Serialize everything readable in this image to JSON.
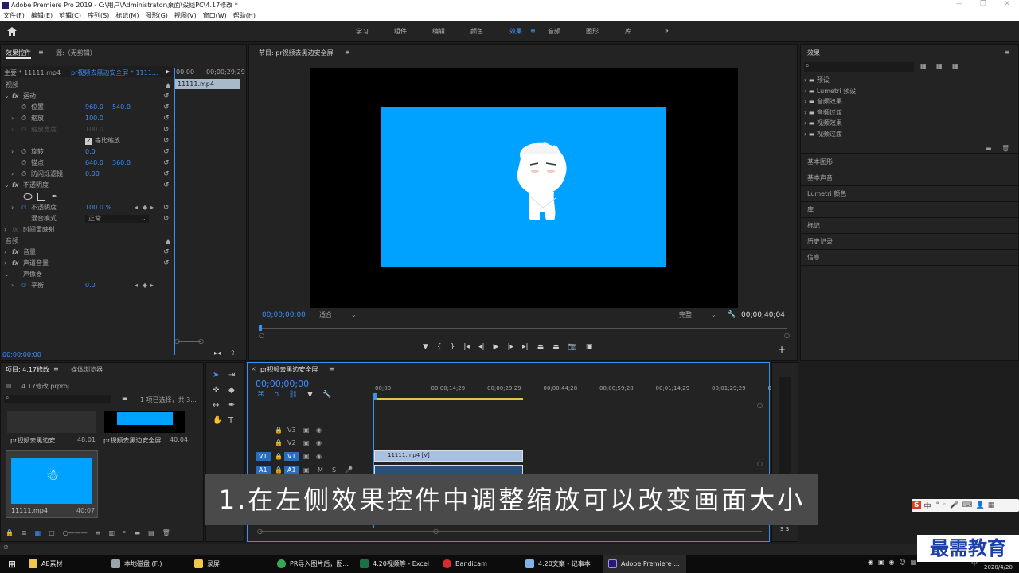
{
  "window": {
    "title": "Adobe Premiere Pro 2019 - C:\\用户\\Administrator\\桌面\\设线PC\\4.17修改 *",
    "minimize": "—",
    "restore": "❐",
    "close": "✕"
  },
  "menu": [
    "文件(F)",
    "编辑(E)",
    "剪辑(C)",
    "序列(S)",
    "标记(M)",
    "图形(G)",
    "视图(V)",
    "窗口(W)",
    "帮助(H)"
  ],
  "workspaces": [
    "学习",
    "组件",
    "编辑",
    "颜色",
    "效果",
    "音频",
    "图形",
    "库"
  ],
  "workspace_active": "效果",
  "workspace_more": "»",
  "effect_controls": {
    "tab": "效果控件",
    "tab_menu": "≡",
    "source_tab": "源:（无剪辑）",
    "master": "主要 * 11111.mp4",
    "sequence": "pr视频去黑边安全屏 * 1111...",
    "time_start": "00;00",
    "time_end": "00;00;29;29",
    "clip_chip": "11111.mp4",
    "video_header": "视频",
    "motion": "运动",
    "position_label": "位置",
    "position_x": "960.0",
    "position_y": "540.0",
    "scale_label": "缩放",
    "scale_value": "100.0",
    "scale_width_label": "缩放宽度",
    "scale_width_value": "100.0",
    "uniform_scale": "等比缩放",
    "rotation_label": "旋转",
    "rotation_value": "0.0",
    "anchor_label": "锚点",
    "anchor_x": "640.0",
    "anchor_y": "360.0",
    "antiflicker_label": "防闪烁滤镜",
    "antiflicker_value": "0.00",
    "opacity_header": "不透明度",
    "opacity_label": "不透明度",
    "opacity_value": "100.0 %",
    "blend_label": "混合模式",
    "blend_value": "正常",
    "time_remap": "时间重映射",
    "audio_header": "音频",
    "volume": "音量",
    "channel_volume": "声道音量",
    "panner": "声像器",
    "balance_label": "平衡",
    "balance_value": "0.0",
    "timecode": "00;00;00;00"
  },
  "program": {
    "title": "节目: pr视频去黑边安全屏",
    "menu": "≡",
    "timecode": "00;00;00;00",
    "fit": "适合",
    "quality": "完整",
    "duration": "00;00;40;04",
    "colors": {
      "frame_bg": "#000000",
      "video_bg": "#00a2ff"
    }
  },
  "effects_panel": {
    "title": "效果",
    "menu": "≡",
    "search_placeholder": "",
    "folders": [
      "预设",
      "Lumetri 预设",
      "音频效果",
      "音频过渡",
      "视频效果",
      "视频过渡"
    ],
    "sections": [
      "基本图形",
      "基本声音",
      "Lumetri 颜色",
      "库",
      "标记",
      "历史记录",
      "信息"
    ]
  },
  "project": {
    "tab": "项目: 4.17修改",
    "menu": "≡",
    "browser_tab": "媒体浏览器",
    "file": "4.17修改.prproj",
    "selection": "1 项已选择，共 3...",
    "items": [
      {
        "name": "pr视频去黑边安...",
        "duration": "48;01"
      },
      {
        "name": "pr视频去黑边安全屏",
        "duration": "40;04"
      },
      {
        "name": "11111.mp4",
        "duration": "40:07"
      }
    ]
  },
  "timeline": {
    "tab": "pr视频去黑边安全屏",
    "menu": "≡",
    "close": "×",
    "timecode": "00;00;00;00",
    "ruler": [
      "00;00",
      "00;00;14;29",
      "00;00;29;29",
      "00;00;44;28",
      "00;00;59;28",
      "00;01;14;29",
      "00;01;29;29",
      "00;0"
    ],
    "tracks": [
      "V3",
      "V2",
      "V1",
      "A1"
    ],
    "source_v1": "V1",
    "source_a1": "A1",
    "clip_video": "11111.mp4 [V]"
  },
  "subtitle": "1.在左侧效果控件中调整缩放可以改变画面大小",
  "ime": {
    "brand": "S",
    "lang": "中"
  },
  "watermark": "最需教育",
  "taskbar": {
    "items": [
      "AE素材",
      "本地磁盘 (F:)",
      "录屏",
      "PR导入图片后，图...",
      "4.20视频等 - Excel",
      "Bandicam",
      "4.20文案 - 记事本",
      "Adobe Premiere ..."
    ],
    "clock_date": "2020/4/20",
    "ime_lang": "中"
  },
  "audio_meter": {
    "labels": "S S"
  }
}
